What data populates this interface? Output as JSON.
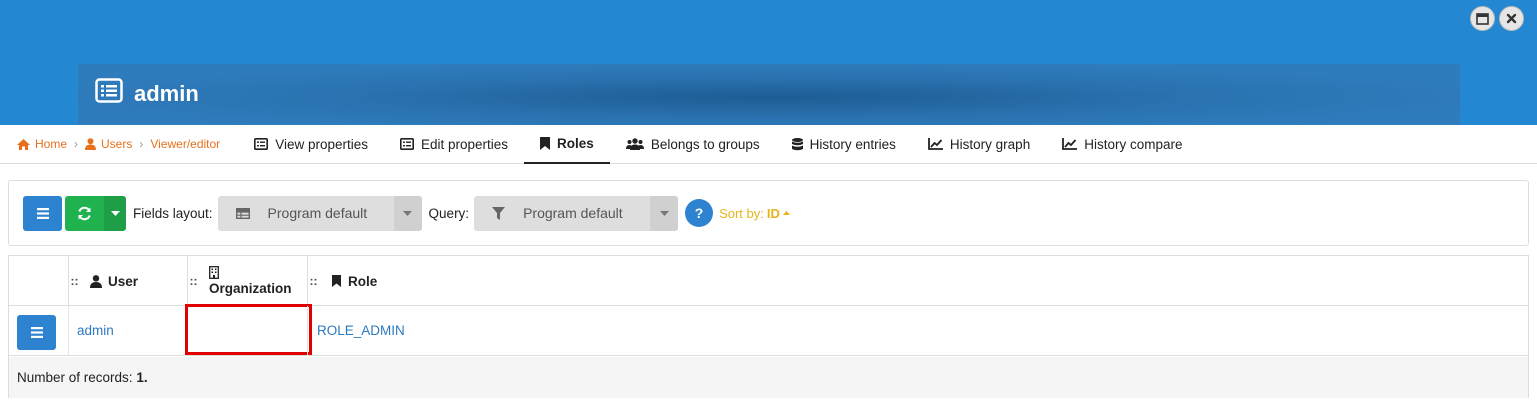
{
  "window": {
    "maximize_icon": "window-maximize-icon",
    "close_icon": "close-icon"
  },
  "header": {
    "icon": "list-icon",
    "title": "admin"
  },
  "breadcrumb": [
    {
      "label": "Home",
      "icon": "home-icon"
    },
    {
      "label": "Users",
      "icon": "user-icon"
    },
    {
      "label": "Viewer/editor",
      "icon": ""
    }
  ],
  "tabs": [
    {
      "label": "View properties",
      "icon": "list-alt-icon",
      "active": false
    },
    {
      "label": "Edit properties",
      "icon": "list-alt-icon",
      "active": false
    },
    {
      "label": "Roles",
      "icon": "bookmark-icon",
      "active": true
    },
    {
      "label": "Belongs to groups",
      "icon": "users-icon",
      "active": false
    },
    {
      "label": "History entries",
      "icon": "database-icon",
      "active": false
    },
    {
      "label": "History graph",
      "icon": "line-chart-icon",
      "active": false
    },
    {
      "label": "History compare",
      "icon": "line-chart-icon",
      "active": false
    }
  ],
  "toolbar": {
    "fields_layout_label": "Fields layout:",
    "fields_layout_value": "Program default",
    "query_label": "Query:",
    "query_value": "Program default",
    "help_label": "?",
    "sort_label": "Sort by:",
    "sort_field": "ID"
  },
  "table": {
    "columns": [
      {
        "label": "User",
        "icon": "user-icon"
      },
      {
        "label": "Organization",
        "icon": "building-icon"
      },
      {
        "label": "Role",
        "icon": "bookmark-icon"
      }
    ],
    "drag_handle": "::",
    "rows": [
      {
        "user": "admin",
        "organization": "",
        "role": "ROLE_ADMIN"
      }
    ],
    "footer_label": "Number of records:",
    "footer_count": "1."
  },
  "colors": {
    "header_blue": "#2387d2",
    "accent_orange": "#e8701c",
    "button_blue": "#2d83cf",
    "button_green": "#21b250",
    "sort_yellow": "#e8b41c",
    "highlight_red": "#e00000"
  }
}
